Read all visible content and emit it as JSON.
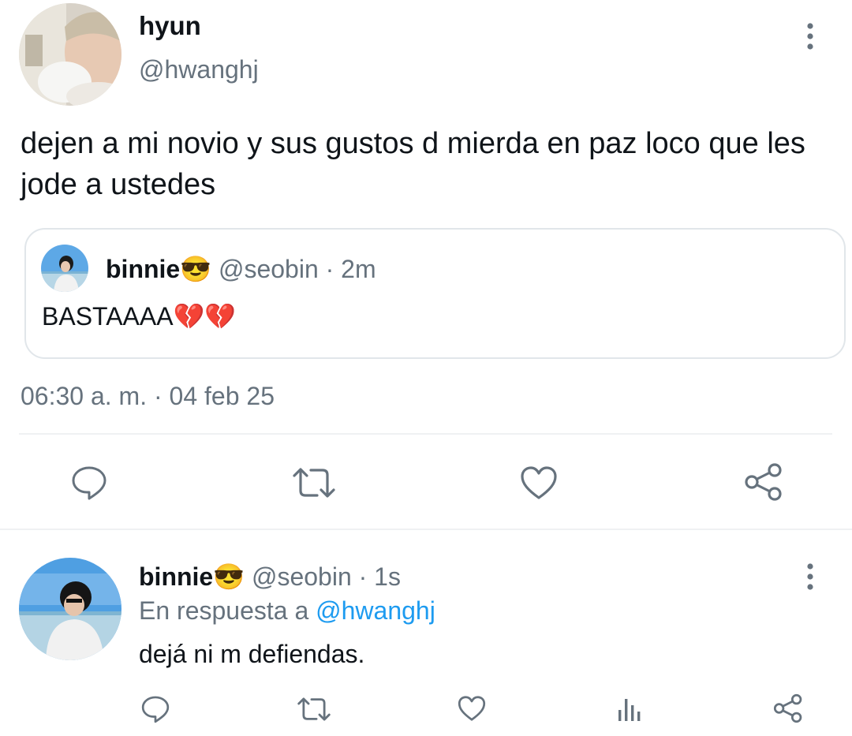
{
  "main_tweet": {
    "display_name": "hyun",
    "handle": "@hwanghj",
    "text": "dejen a mi novio y sus gustos d mierda en paz loco que les jode a ustedes",
    "timestamp": "06:30 a. m. · 04 feb 25",
    "quoted_tweet": {
      "display_name": "binnie😎",
      "handle": "@seobin",
      "time": "· 2m",
      "text": "BASTAAAA💔💔"
    },
    "actions": [
      "reply-icon",
      "retweet-icon",
      "like-icon",
      "share-icon"
    ]
  },
  "reply_tweet": {
    "display_name": "binnie😎",
    "handle": "@seobin",
    "time": "· 1s",
    "reply_prefix": "En respuesta a",
    "reply_to": "@hwanghj",
    "text": "dejá ni m defiendas.",
    "actions": [
      "reply-icon",
      "retweet-icon",
      "like-icon",
      "views-icon",
      "share-icon"
    ]
  },
  "colors": {
    "text": "#0f1419",
    "muted": "#66727d",
    "link": "#1d9bf0",
    "border": "#e1e6ea"
  }
}
